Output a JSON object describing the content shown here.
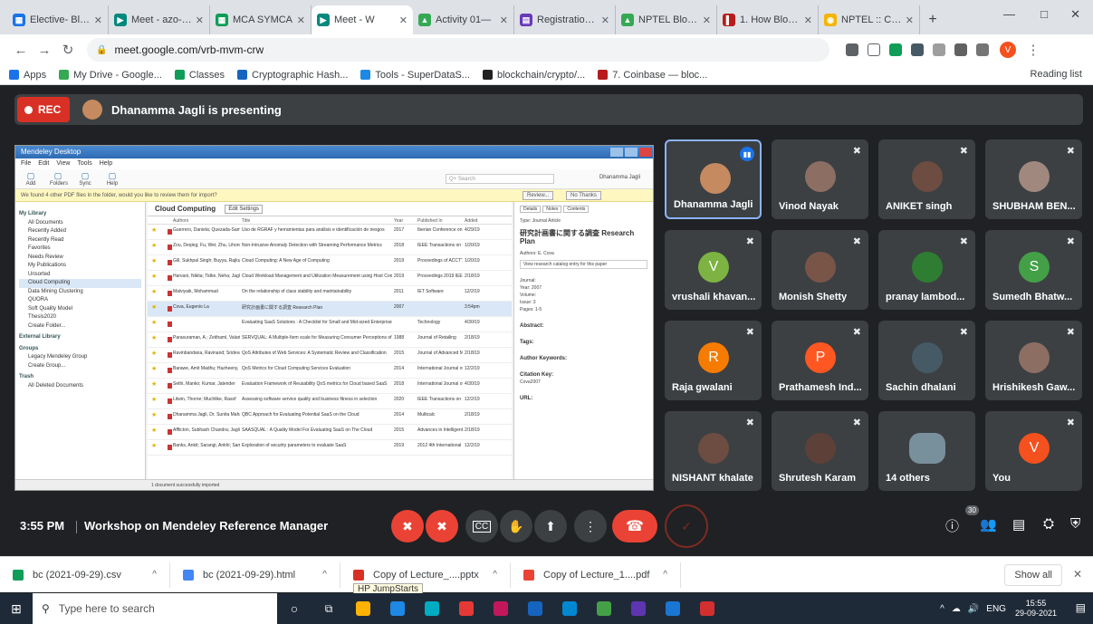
{
  "browser": {
    "tabs": [
      {
        "label": "Elective- Block",
        "color": "#1a73e8",
        "glyph": "▦"
      },
      {
        "label": "Meet - azo-xyi",
        "color": "#00897b",
        "glyph": "▶"
      },
      {
        "label": "MCA SYMCA",
        "color": "#0f9d58",
        "glyph": "▦"
      },
      {
        "label": "Meet - W",
        "color": "#00897b",
        "glyph": "▶",
        "active": true
      },
      {
        "label": "Activity 01—",
        "color": "#34a853",
        "glyph": "▲"
      },
      {
        "label": "Registration F",
        "color": "#673ab7",
        "glyph": "▤"
      },
      {
        "label": "NPTEL Blockc",
        "color": "#34a853",
        "glyph": "▲"
      },
      {
        "label": "1. How Blockc",
        "color": "#b71c1c",
        "glyph": "▌"
      },
      {
        "label": "NPTEL :: Comp",
        "color": "#f4b400",
        "glyph": "◉"
      }
    ],
    "new_tab": "+",
    "window_controls": [
      "—",
      "□",
      "✕"
    ],
    "url": "meet.google.com/vrb-mvm-crw",
    "bookmarks": [
      {
        "label": "Apps",
        "color": "#1a73e8"
      },
      {
        "label": "My Drive - Google...",
        "color": "#34a853"
      },
      {
        "label": "Classes",
        "color": "#0f9d58"
      },
      {
        "label": "Cryptographic Hash...",
        "color": "#1565c0"
      },
      {
        "label": "Tools - SuperDataS...",
        "color": "#1e88e5"
      },
      {
        "label": "blockchain/crypto/...",
        "color": "#212121"
      },
      {
        "label": "7. Coinbase — bloc...",
        "color": "#b71c1c"
      }
    ],
    "reading_list": "Reading list",
    "profile_initial": "V"
  },
  "meet": {
    "rec_label": "REC",
    "presenting_text": "Dhanamma Jagli is presenting",
    "time": "3:55 PM",
    "meeting_title": "Workshop on Mendeley Reference Manager",
    "participant_count": "30",
    "participants": [
      {
        "name": "Dhanamma Jagli",
        "avatar": "photo",
        "color": "#c58a5f",
        "active": true
      },
      {
        "name": "Vinod Nayak",
        "avatar": "photo",
        "color": "#8d6e63"
      },
      {
        "name": "ANIKET singh",
        "avatar": "photo",
        "color": "#6d4c41"
      },
      {
        "name": "SHUBHAM BEN...",
        "avatar": "photo",
        "color": "#a1887f"
      },
      {
        "name": "vrushali khavan...",
        "avatar": "V",
        "color": "#7cb342"
      },
      {
        "name": "Monish Shetty",
        "avatar": "photo",
        "color": "#795548"
      },
      {
        "name": "pranay lambod...",
        "avatar": "photo",
        "color": "#2e7d32"
      },
      {
        "name": "Sumedh Bhatw...",
        "avatar": "S",
        "color": "#43a047"
      },
      {
        "name": "Raja gwalani",
        "avatar": "R",
        "color": "#f57c00"
      },
      {
        "name": "Prathamesh Ind...",
        "avatar": "P",
        "color": "#ff5722"
      },
      {
        "name": "Sachin dhalani",
        "avatar": "photo",
        "color": "#455a64"
      },
      {
        "name": "Hrishikesh Gaw...",
        "avatar": "photo",
        "color": "#8d6e63"
      },
      {
        "name": "NISHANT khalate",
        "avatar": "photo",
        "color": "#6d4c41"
      },
      {
        "name": "Shrutesh Karam",
        "avatar": "photo",
        "color": "#5d4037"
      },
      {
        "name": "14 others",
        "avatar": "group",
        "color": "#78909c"
      },
      {
        "name": "You",
        "avatar": "V",
        "color": "#f4511e"
      }
    ]
  },
  "mendeley": {
    "title": "Mendeley Desktop",
    "menu": [
      "File",
      "Edit",
      "View",
      "Tools",
      "Help"
    ],
    "toolbar": [
      "Add",
      "Folders",
      "Sync",
      "Help"
    ],
    "search_placeholder": "Q+ Search",
    "user": "Dhanamma Jagli",
    "notice": "We found 4 other PDF files in the folder, would you like to review them for import?",
    "notice_buttons": [
      "Review...",
      "No Thanks"
    ],
    "sidebar": [
      {
        "t": "My Library",
        "h": true
      },
      {
        "t": "All Documents"
      },
      {
        "t": "Recently Added"
      },
      {
        "t": "Recently Read"
      },
      {
        "t": "Favorites"
      },
      {
        "t": "Needs Review"
      },
      {
        "t": "My Publications"
      },
      {
        "t": "Unsorted"
      },
      {
        "t": "Cloud Computing",
        "sel": true
      },
      {
        "t": "Data Mining Clustering"
      },
      {
        "t": "QUORA"
      },
      {
        "t": "Soft Quality Model"
      },
      {
        "t": "Thesis2020"
      },
      {
        "t": "Create Folder..."
      },
      {
        "t": "External Library",
        "h": true
      },
      {
        "t": "Groups",
        "h": true
      },
      {
        "t": "Legacy Mendeley Group"
      },
      {
        "t": "Create Group..."
      },
      {
        "t": "Trash",
        "h": true
      },
      {
        "t": "All Deleted Documents"
      }
    ],
    "folder_title": "Cloud Computing",
    "edit_settings": "Edit Settings",
    "columns": [
      "Authors",
      "Title",
      "Year",
      "Published In",
      "Added"
    ],
    "rows": [
      [
        "Guerrero, Daniela; Quezada-Sarmiento, Pablo Alejandro",
        "Uso de RGRAF y herramientas para análisis e identificación de riesgos",
        "2017",
        "Iberian Conference on",
        "4/29/19"
      ],
      [
        "Zou, Deqing; Fu, Wei; Zhu, Lihong",
        "Non-Intrusive Anomaly Detection with Streaming Performance Metrics",
        "2018",
        "IEEE Transactions on Emerging Tr...",
        "1/20/19"
      ],
      [
        "Gill, Sukhpal Singh; Buyya, Rajkumar",
        "Cloud Computing: A New Age of Computing",
        "2019",
        "Proceedings of ACCT'19",
        "1/20/19"
      ],
      [
        "Harvani, Nikita; Tidke, Neha; Jagli, Dhanamma",
        "Cloud Workload Management and Utilization Measurement using Host Controller",
        "2019",
        "Proceedings 2019 IEEE Inter...",
        "2/18/19"
      ],
      [
        "Malviyaik, Mohammad",
        "On the relationship of class stability and maintainability",
        "2011",
        "IET Software",
        "12/2/19"
      ],
      [
        "Cova, Eugenio La",
        "研究計画書に関する調査 Research Plan",
        "2007",
        "",
        "3:54pm"
      ],
      [
        "",
        "Evaluating SaaS Solutions : A Checklist for Small and Mid-sized Enterprises",
        "",
        "Technology",
        "4/30/19"
      ],
      [
        "Parasuraman, A.; Zeithaml, Valarie A.; Berry, Leonard L.",
        "SERVQUAL: A Multiple-Item scale for Measuring Consumer Perceptions of Service Quality",
        "1988",
        "Journal of Retailing",
        "2/18/19"
      ],
      [
        "Ravinbandana, Ravinand; Sridevaram, Sarun",
        "QoS Attributes of Web Services: A Systematic Review and Classification",
        "2015",
        "Journal of Advanced Man...",
        "2/18/19"
      ],
      [
        "Barawe, Amit Madhu; Hazheeny, Second Mohan",
        "QoS Metrics for Cloud Computing Services Evaluation",
        "2014",
        "International Journal of Intell...",
        "12/2/19"
      ],
      [
        "Sethi, Manko; Kumar, Jatender",
        "Evaluation Framework of Reusability QoS metrics for Cloud based SaaS",
        "2018",
        "International Journal of Com...",
        "4/30/19"
      ],
      [
        "Litwin, Thorne; Muchlike, Rasof",
        "Assessing software service quality and business fitness in selection",
        "2020",
        "IEEE Transactions on Software En...",
        "12/2/19"
      ],
      [
        "Dhanamma Jagli, Dr. Sunita Mahajan",
        "QBC Approach for Evaluating Potential SaaS on the Cloud",
        "2014",
        "Multicalc",
        "2/18/19"
      ],
      [
        "Afflicton, Subhash Chandra; Jagli, Mrs Dhanamma; Purohit",
        "SAASQUAL : A Quality Model For Evaluating SaaS on The Cloud",
        "2015",
        "Advances in Intelligent Syst...",
        "2/18/19"
      ],
      [
        "Banks, Ankit; Sarangi, Ankhi; Sam, Mangal Lee; Hoon Jae",
        "Exploration of security parameters to evaluate SaaS",
        "2019",
        "2012 4th International C...",
        "12/2/19"
      ]
    ],
    "detail_tabs": [
      "Details",
      "Notes",
      "Contents"
    ],
    "detail_type": "Type: Journal Article",
    "detail_title": "研究計画書に関する調査 Research Plan",
    "detail_authors": "Authors: E. Cova",
    "detail_catalog": "View research catalog entry for this paper",
    "detail_fields": [
      "Journal:",
      "Year: 2007",
      "Volume:",
      "Issue: 3",
      "Pages: 1-5"
    ],
    "detail_sections": [
      "Abstract:",
      "Tags:",
      "Author Keywords:",
      "Citation Key:",
      "URL:"
    ],
    "detail_citekey": "Cova2007",
    "status": "1 document successfully imported"
  },
  "controls": {
    "mic": "✖",
    "cam": "✖",
    "cc": "CC",
    "hand": "✋",
    "present": "⬆",
    "more": "⋮",
    "hangup": "☎",
    "ring": "✓",
    "info": "ⓘ",
    "people": "👥",
    "chat": "▤",
    "activities": "⛭",
    "safety": "⛨"
  },
  "downloads": [
    {
      "name": "bc (2021-09-29).csv",
      "color": "#0f9d58"
    },
    {
      "name": "bc (2021-09-29).html",
      "color": "#4285f4"
    },
    {
      "name": "Copy of Lecture_....pptx",
      "color": "#d93025"
    },
    {
      "name": "Copy of Lecture_1....pdf",
      "color": "#ea4335"
    }
  ],
  "downloads_show_all": "Show all",
  "tooltip": "HP JumpStarts",
  "taskbar": {
    "search": "Type here to search",
    "apps": [
      "#ffb300",
      "#1e88e5",
      "#00acc1",
      "#e53935",
      "#c2185b",
      "#1565c0",
      "#0288d1",
      "#43a047",
      "#5e35b1",
      "#1976d2",
      "#d32f2f"
    ],
    "lang": "ENG",
    "time": "15:55",
    "date": "29-09-2021"
  }
}
